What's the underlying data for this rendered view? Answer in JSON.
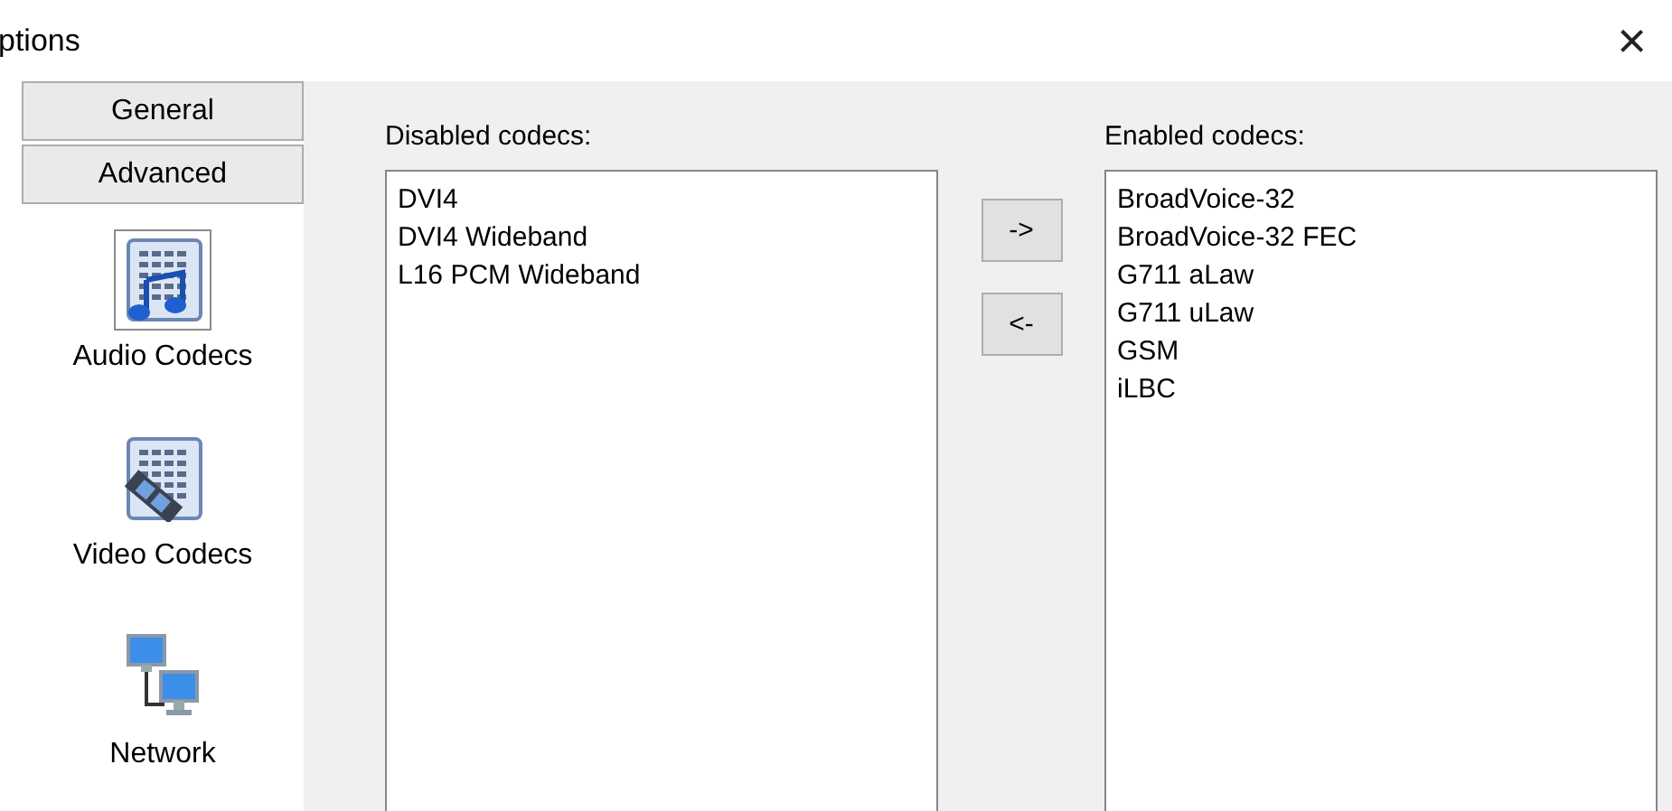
{
  "window": {
    "title": "ptions",
    "close": "×"
  },
  "sidebar": {
    "tabs": [
      {
        "label": "General"
      },
      {
        "label": "Advanced"
      }
    ],
    "items": [
      {
        "label": "Audio Codecs",
        "kind": "audio",
        "selected": true
      },
      {
        "label": "Video Codecs",
        "kind": "video",
        "selected": false
      },
      {
        "label": "Network",
        "kind": "network",
        "selected": false
      }
    ]
  },
  "disabled": {
    "label": "Disabled codecs:",
    "items": [
      "DVI4",
      "DVI4 Wideband",
      "L16 PCM Wideband"
    ]
  },
  "buttons": [
    {
      "label": "->"
    },
    {
      "label": "<-"
    }
  ],
  "enabled": {
    "label": "Enabled codecs:",
    "items": [
      "BroadVoice-32",
      "BroadVoice-32 FEC",
      "G711 aLaw",
      "G711 uLaw",
      "GSM",
      "iLBC"
    ]
  }
}
